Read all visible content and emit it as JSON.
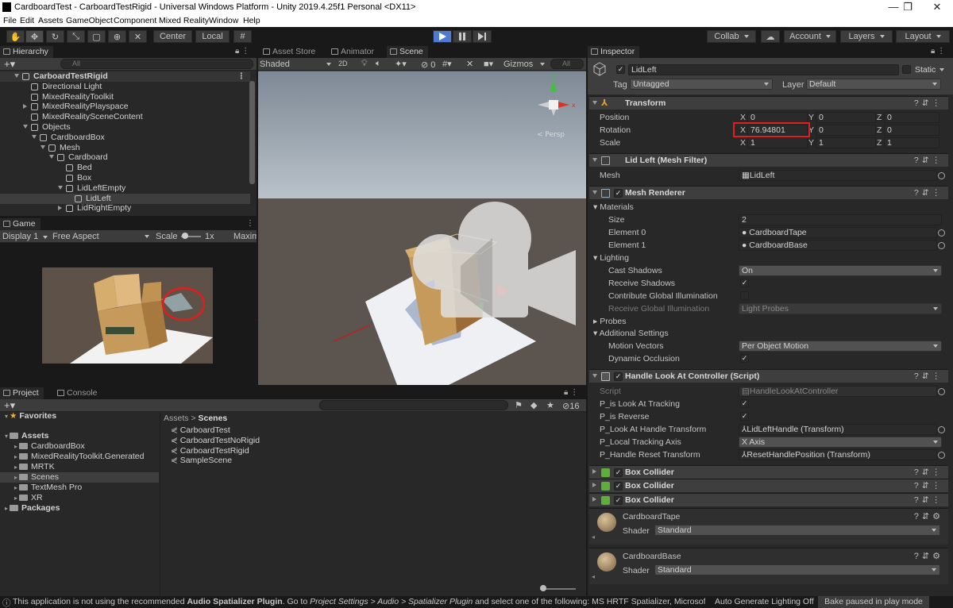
{
  "window": {
    "title": "CardboardTest - CarboardTestRigid - Universal Windows Platform - Unity 2019.4.25f1 Personal <DX11>",
    "controls": [
      "—",
      "❐",
      "✕"
    ]
  },
  "menu": [
    "File",
    "Edit",
    "Assets",
    "GameObject",
    "Component",
    "Mixed Reality",
    "Window",
    "Help"
  ],
  "toolbar": {
    "pivot": "Center",
    "space": "Local",
    "collab": "Collab",
    "account": "Account",
    "layers": "Layers",
    "layout": "Layout"
  },
  "hierarchy": {
    "tab": "Hierarchy",
    "search_placeholder": "All",
    "items": [
      {
        "label": "CarboardTestRigid",
        "depth": 0,
        "fold": "open",
        "root": true
      },
      {
        "label": "Directional Light",
        "depth": 1,
        "fold": "none"
      },
      {
        "label": "MixedRealityToolkit",
        "depth": 1,
        "fold": "none"
      },
      {
        "label": "MixedRealityPlayspace",
        "depth": 1,
        "fold": "closed"
      },
      {
        "label": "MixedRealitySceneContent",
        "depth": 1,
        "fold": "none"
      },
      {
        "label": "Objects",
        "depth": 1,
        "fold": "open"
      },
      {
        "label": "CardboardBox",
        "depth": 2,
        "fold": "open"
      },
      {
        "label": "Mesh",
        "depth": 3,
        "fold": "open"
      },
      {
        "label": "Cardboard",
        "depth": 4,
        "fold": "open"
      },
      {
        "label": "Bed",
        "depth": 5,
        "fold": "none"
      },
      {
        "label": "Box",
        "depth": 5,
        "fold": "none"
      },
      {
        "label": "LidLeftEmpty",
        "depth": 5,
        "fold": "open"
      },
      {
        "label": "LidLeft",
        "depth": 6,
        "fold": "none",
        "selected": true
      },
      {
        "label": "LidRightEmpty",
        "depth": 5,
        "fold": "closed"
      }
    ]
  },
  "game": {
    "tab": "Game",
    "display": "Display 1",
    "aspect": "Free Aspect",
    "scale_label": "Scale",
    "scale_value": "1x",
    "maximize": "Maxim"
  },
  "scene": {
    "tabs": [
      "Asset Store",
      "Animator",
      "Scene"
    ],
    "shading": "Shaded",
    "mode_2d": "2D",
    "hidden_count": "0",
    "gizmos": "Gizmos",
    "search_placeholder": "All",
    "gizmo_label": "< Persp"
  },
  "project": {
    "tabs": [
      "Project",
      "Console"
    ],
    "tree": [
      {
        "label": "Favorites",
        "depth": 0,
        "kind": "favorites",
        "bold": true
      },
      {
        "label": "Assets",
        "depth": 0,
        "kind": "folder",
        "bold": true
      },
      {
        "label": "CardboardBox",
        "depth": 1,
        "kind": "folder"
      },
      {
        "label": "MixedRealityToolkit.Generated",
        "depth": 1,
        "kind": "folder"
      },
      {
        "label": "MRTK",
        "depth": 1,
        "kind": "folder"
      },
      {
        "label": "Scenes",
        "depth": 1,
        "kind": "folder",
        "selected": true
      },
      {
        "label": "TextMesh Pro",
        "depth": 1,
        "kind": "folder"
      },
      {
        "label": "XR",
        "depth": 1,
        "kind": "folder"
      },
      {
        "label": "Packages",
        "depth": 0,
        "kind": "folder",
        "bold": true
      }
    ],
    "breadcrumb": [
      "Assets",
      "Scenes"
    ],
    "files": [
      "CarboardTest",
      "CarboardTestNoRigid",
      "CarboardTestRigid",
      "SampleScene"
    ],
    "hidden_count": "16"
  },
  "inspector": {
    "tab": "Inspector",
    "object_name": "LidLeft",
    "static_label": "Static",
    "tag_label": "Tag",
    "tag_value": "Untagged",
    "layer_label": "Layer",
    "layer_value": "Default",
    "transform": {
      "title": "Transform",
      "rows": [
        {
          "label": "Position",
          "x": "0",
          "y": "0",
          "z": "0"
        },
        {
          "label": "Rotation",
          "x": "76.94801",
          "y": "0",
          "z": "0",
          "highlight": true
        },
        {
          "label": "Scale",
          "x": "1",
          "y": "1",
          "z": "1"
        }
      ]
    },
    "mesh_filter": {
      "title": "Lid Left (Mesh Filter)",
      "mesh_label": "Mesh",
      "mesh_value": "LidLeft"
    },
    "mesh_renderer": {
      "title": "Mesh Renderer",
      "materials_label": "Materials",
      "size_label": "Size",
      "size_value": "2",
      "element0_label": "Element 0",
      "element0_value": "CardboardTape",
      "element1_label": "Element 1",
      "element1_value": "CardboardBase",
      "lighting_label": "Lighting",
      "cast_shadows_label": "Cast Shadows",
      "cast_shadows_value": "On",
      "receive_shadows_label": "Receive Shadows",
      "contribute_gi_label": "Contribute Global Illumination",
      "receive_gi_label": "Receive Global Illumination",
      "receive_gi_value": "Light Probes",
      "probes_label": "Probes",
      "additional_label": "Additional Settings",
      "motion_vectors_label": "Motion Vectors",
      "motion_vectors_value": "Per Object Motion",
      "dynamic_occlusion_label": "Dynamic Occlusion"
    },
    "script": {
      "title": "Handle Look At Controller (Script)",
      "script_label": "Script",
      "script_value": "HandleLookAtController",
      "tracking_label": "P_is Look At Tracking",
      "reverse_label": "P_is Reverse",
      "handle_transform_label": "P_Look At Handle Transform",
      "handle_transform_value": "LidLeftHandle (Transform)",
      "axis_label": "P_Local Tracking Axis",
      "axis_value": "X Axis",
      "reset_label": "P_Handle Reset Transform",
      "reset_value": "ResetHandlePosition (Transform)"
    },
    "box_colliders": [
      "Box Collider",
      "Box Collider",
      "Box Collider"
    ],
    "materials": [
      {
        "name": "CardboardTape",
        "shader_label": "Shader",
        "shader_value": "Standard"
      },
      {
        "name": "CardboardBase",
        "shader_label": "Shader",
        "shader_value": "Standard"
      }
    ]
  },
  "status": {
    "message_prefix": "This application is not using the recommended ",
    "message_bold": "Audio Spatializer Plugin",
    "message_mid": ". Go to ",
    "message_italic": "Project Settings > Audio > Spatializer Plugin",
    "message_suffix": " and select one of the following: MS HRTF Spatializer, Microsoft Spatializer",
    "auto_lighting": "Auto Generate Lighting Off",
    "bake": "Bake paused in play mode"
  },
  "colors": {
    "accent_play": "#4c7bd1",
    "highlight_box": "#e11d1d",
    "selection": "#2c5d87"
  }
}
